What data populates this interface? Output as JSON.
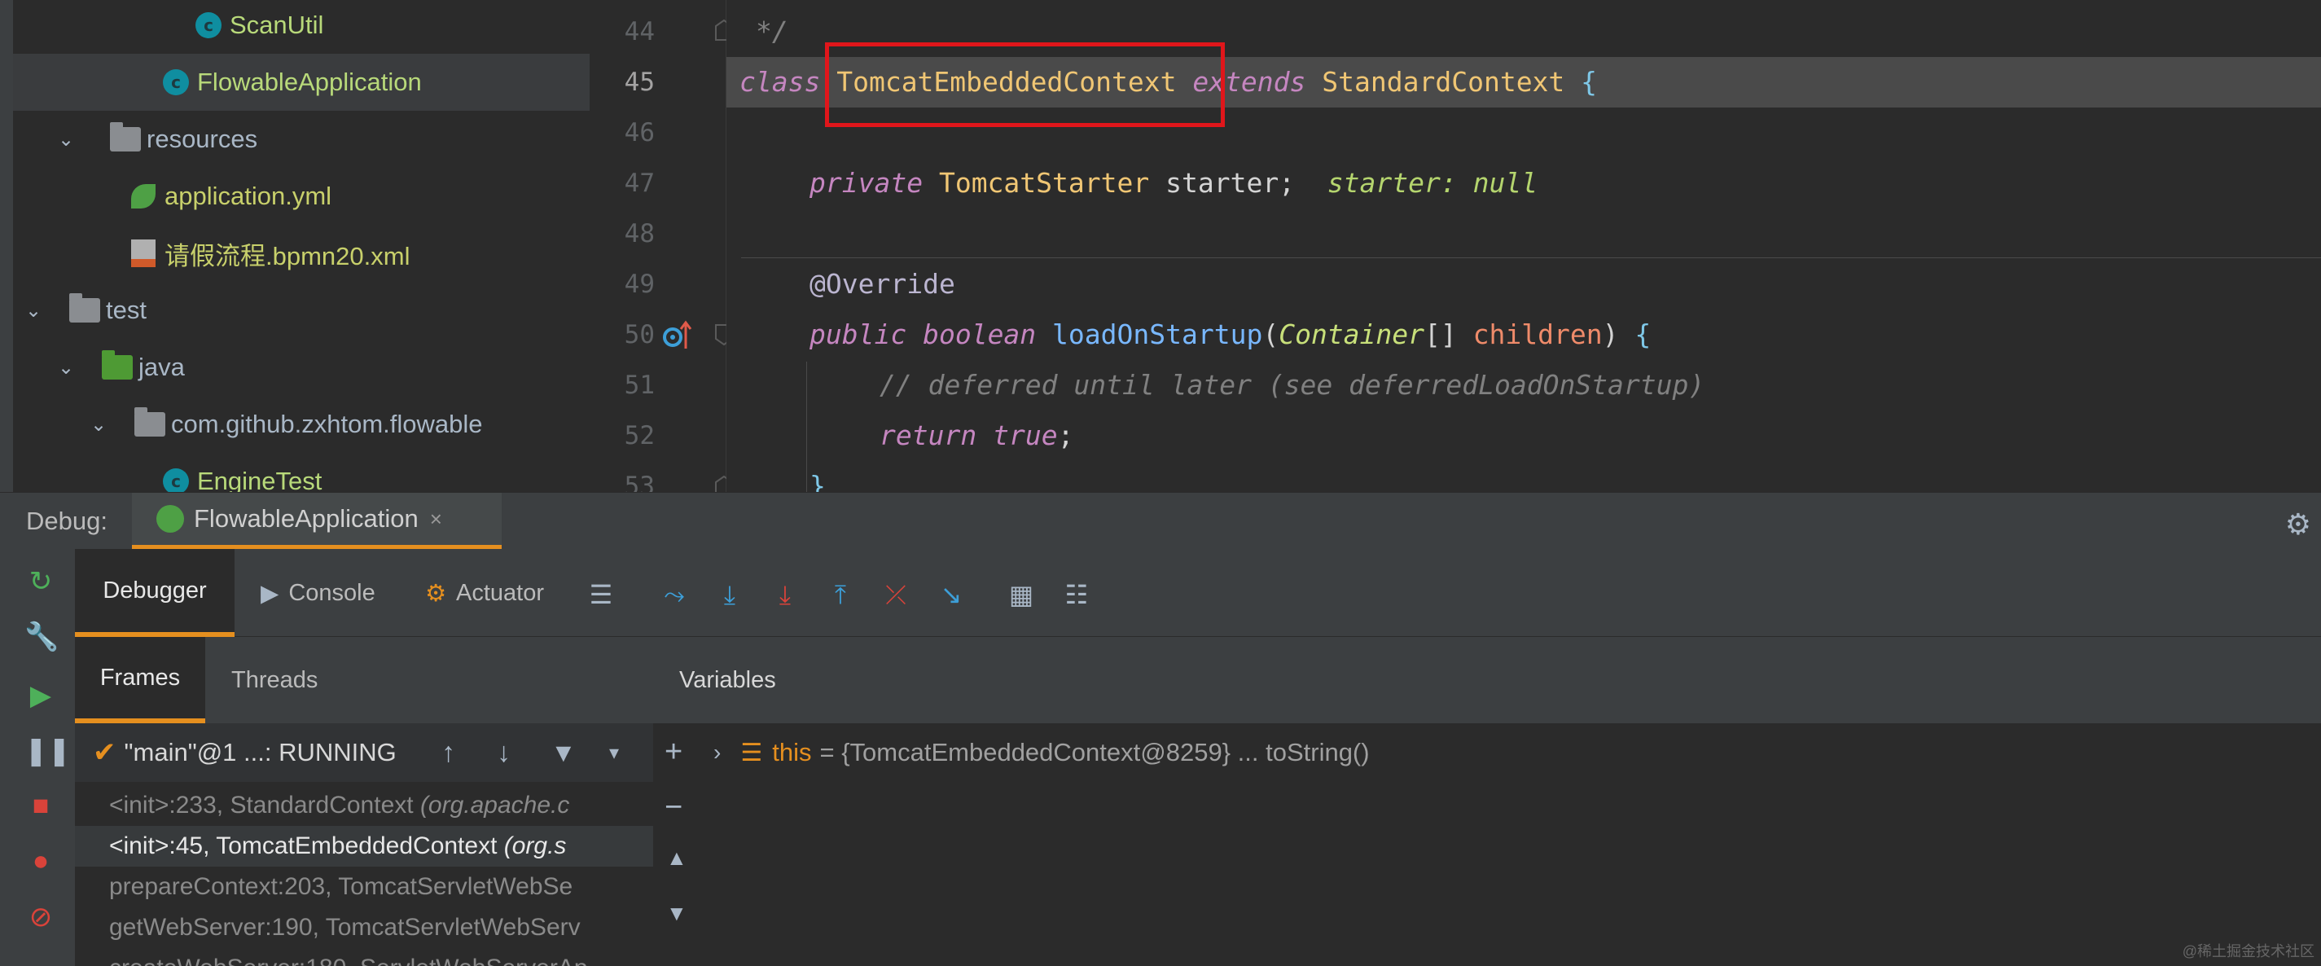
{
  "project_tree": {
    "rows": [
      {
        "label": "ScanUtil",
        "icon": "class-icon"
      },
      {
        "label": "FlowableApplication",
        "icon": "spring-boot-run-icon",
        "selected": true
      },
      {
        "label": "resources",
        "icon": "resources-folder-icon"
      },
      {
        "label": "application.yml",
        "icon": "spring-config-icon"
      },
      {
        "label": "请假流程.bpmn20.xml",
        "icon": "xml-file-icon"
      },
      {
        "label": "test",
        "icon": "folder-icon"
      },
      {
        "label": "java",
        "icon": "test-source-folder-icon"
      },
      {
        "label": "com.github.zxhtom.flowable",
        "icon": "package-icon"
      },
      {
        "label": "EngineTest",
        "icon": "test-class-icon"
      }
    ]
  },
  "editor": {
    "line_numbers": [
      "44",
      "45",
      "46",
      "47",
      "48",
      "49",
      "50",
      "51",
      "52",
      "53"
    ],
    "current_line": "45",
    "code": {
      "l44": "*/",
      "l45_kw1": "class",
      "l45_name": "TomcatEmbeddedContext",
      "l45_kw2": "extends",
      "l45_super": "StandardContext",
      "l45_brace": "{",
      "l47_kw": "private",
      "l47_type": "TomcatStarter",
      "l47_var": "starter;",
      "l47_hint": "starter: null",
      "l49_ann": "@Override",
      "l50_kw1": "public",
      "l50_kw2": "boolean",
      "l50_fn": "loadOnStartup",
      "l50_open": "(",
      "l50_type": "Container",
      "l50_arr": "[]",
      "l50_param": "children",
      "l50_close": ")",
      "l50_brace": "{",
      "l51_comment": "// deferred until later (see deferredLoadOnStartup)",
      "l52_kw": "return",
      "l52_val": "true",
      "l52_semi": ";",
      "l53": "}"
    }
  },
  "debug": {
    "label": "Debug:",
    "session_tab": "FlowableApplication",
    "close_glyph": "×",
    "toolbar": {
      "debugger": "Debugger",
      "console": "Console",
      "actuator": "Actuator"
    },
    "subtabs": {
      "frames": "Frames",
      "threads": "Threads",
      "variables": "Variables"
    },
    "thread": "\"main\"@1 ...: RUNNING",
    "frames": [
      {
        "method": "<init>:233, StandardContext ",
        "pkg": "(org.apache.c"
      },
      {
        "method": "<init>:45, TomcatEmbeddedContext ",
        "pkg": "(org.s",
        "selected": true
      },
      {
        "method": "prepareContext:203, TomcatServletWebSe",
        "pkg": ""
      },
      {
        "method": "getWebServer:190, TomcatServletWebServ",
        "pkg": ""
      },
      {
        "method": "createWebServer:180, ServletWebServerAp",
        "pkg": ""
      }
    ],
    "variable": {
      "name": "this",
      "value": "= {TomcatEmbeddedContext@8259} ... toString()"
    }
  },
  "watermark": "@稀土掘金技术社区",
  "colors": {
    "accent_orange": "#e58f1f",
    "highlight_box": "#e0161b",
    "background": "#2b2b2b",
    "panel": "#3c3f41"
  }
}
